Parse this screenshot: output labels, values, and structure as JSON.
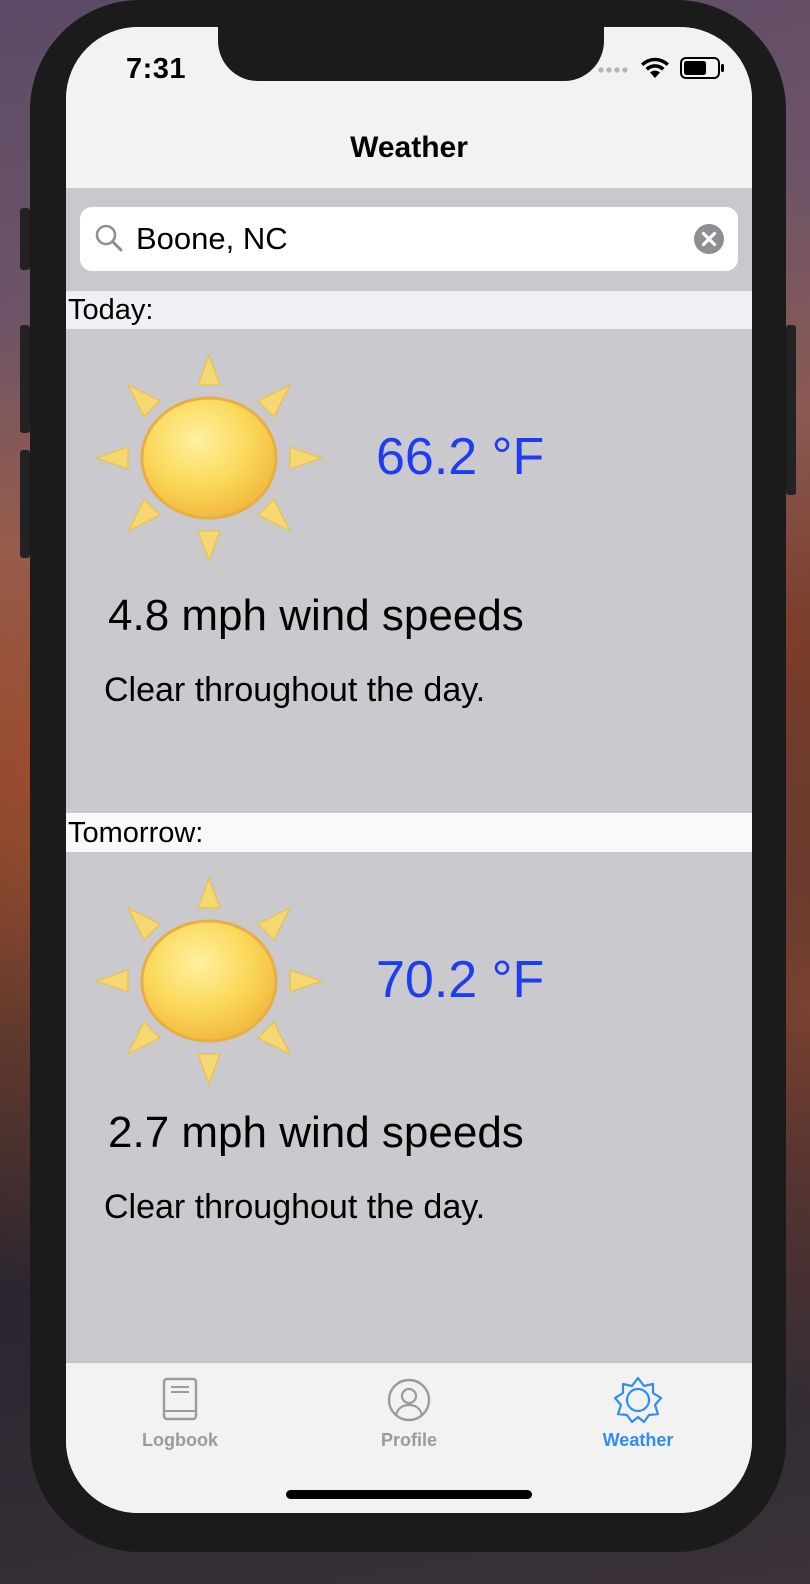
{
  "status_bar": {
    "time": "7:31"
  },
  "nav": {
    "title": "Weather"
  },
  "search": {
    "value": "Boone, NC"
  },
  "today": {
    "header": "Today:",
    "icon": "sun-icon",
    "temperature": "66.2 °F",
    "wind": "4.8 mph wind speeds",
    "summary": "Clear throughout the day."
  },
  "tomorrow": {
    "header": "Tomorrow:",
    "icon": "sun-icon",
    "temperature": "70.2 °F",
    "wind": "2.7 mph wind speeds",
    "summary": "Clear throughout the day."
  },
  "tabs": [
    {
      "label": "Logbook",
      "icon": "book-icon",
      "selected": false
    },
    {
      "label": "Profile",
      "icon": "person-icon",
      "selected": false
    },
    {
      "label": "Weather",
      "icon": "sun-outline-icon",
      "selected": true
    }
  ],
  "colors": {
    "accent": "#2f8df5",
    "temperature": "#1e3df0",
    "panel": "#c9c9ce"
  }
}
